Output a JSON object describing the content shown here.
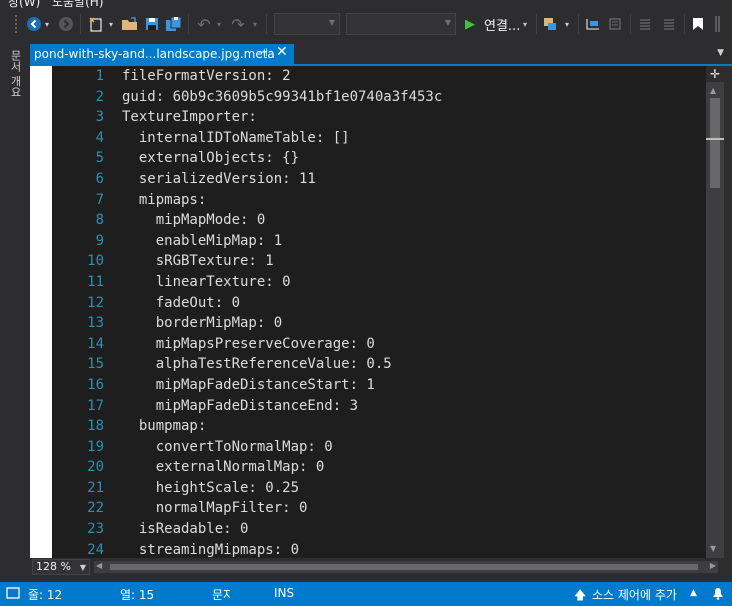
{
  "menu": {
    "items": [
      "창(W)",
      "도움말(H)"
    ]
  },
  "toolbar": {
    "icons": [
      "back-icon",
      "forward-icon",
      "new-project-icon",
      "open-icon",
      "save-icon",
      "save-all-icon",
      "undo-icon",
      "redo-icon",
      "run-icon",
      "attach-icon",
      "bookmark-icon"
    ],
    "run_label": "연결..."
  },
  "side_tab": {
    "label": "문서 개요"
  },
  "tab": {
    "title": "pond-with-sky-and...landscape.jpg.meta",
    "pin": "⊣",
    "close": "✕"
  },
  "editor": {
    "lines": [
      {
        "num": "1",
        "text": "fileFormatVersion: 2"
      },
      {
        "num": "2",
        "text": "guid: 60b9c3609b5c99341bf1e0740a3f453c"
      },
      {
        "num": "3",
        "text": "TextureImporter:"
      },
      {
        "num": "4",
        "text": "  internalIDToNameTable: []"
      },
      {
        "num": "5",
        "text": "  externalObjects: {}"
      },
      {
        "num": "6",
        "text": "  serializedVersion: 11"
      },
      {
        "num": "7",
        "text": "  mipmaps:"
      },
      {
        "num": "8",
        "text": "    mipMapMode: 0"
      },
      {
        "num": "9",
        "text": "    enableMipMap: 1"
      },
      {
        "num": "10",
        "text": "    sRGBTexture: 1"
      },
      {
        "num": "11",
        "text": "    linearTexture: 0"
      },
      {
        "num": "12",
        "text": "    fadeOut: 0"
      },
      {
        "num": "13",
        "text": "    borderMipMap: 0"
      },
      {
        "num": "14",
        "text": "    mipMapsPreserveCoverage: 0"
      },
      {
        "num": "15",
        "text": "    alphaTestReferenceValue: 0.5"
      },
      {
        "num": "16",
        "text": "    mipMapFadeDistanceStart: 1"
      },
      {
        "num": "17",
        "text": "    mipMapFadeDistanceEnd: 3"
      },
      {
        "num": "18",
        "text": "  bumpmap:"
      },
      {
        "num": "19",
        "text": "    convertToNormalMap: 0"
      },
      {
        "num": "20",
        "text": "    externalNormalMap: 0"
      },
      {
        "num": "21",
        "text": "    heightScale: 0.25"
      },
      {
        "num": "22",
        "text": "    normalMapFilter: 0"
      },
      {
        "num": "23",
        "text": "  isReadable: 0"
      },
      {
        "num": "24",
        "text": "  streamingMipmaps: 0"
      }
    ]
  },
  "zoom": {
    "value": "128 %"
  },
  "status": {
    "line": "줄: 12",
    "col": "열: 15",
    "char": "문자",
    "mode": "INS",
    "source_control": "소스 제어에 추가"
  },
  "colors": {
    "accent": "#007acc",
    "editor_bg": "#1e1e1e",
    "line_number": "#2b91af",
    "chrome": "#2d2d30"
  }
}
